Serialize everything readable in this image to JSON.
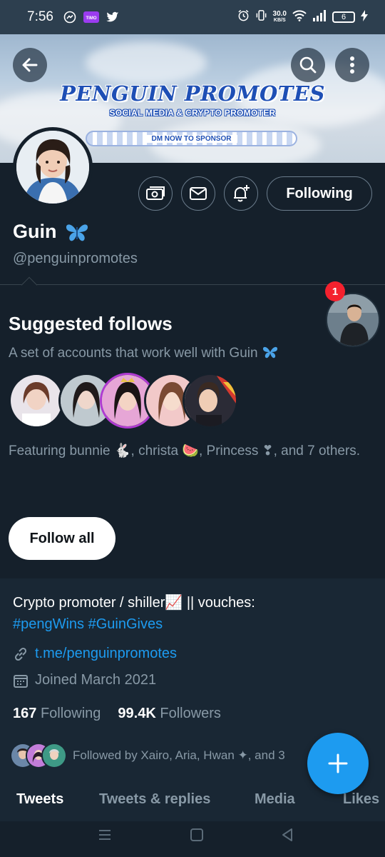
{
  "status_bar": {
    "time": "7:56",
    "net_speed_value": "30.0",
    "net_speed_unit": "KB/S",
    "battery": "6"
  },
  "banner": {
    "title": "PENGUIN PROMOTES",
    "subtitle": "SOCIAL MEDIA & CRYPTO PROMOTER",
    "cta": "DM NOW TO SPONSOR"
  },
  "profile": {
    "name": "Guin",
    "name_emoji": "butterfly",
    "handle": "@penguinpromotes",
    "following_button": "Following"
  },
  "suggested": {
    "title": "Suggested follows",
    "description": "A set of accounts that work well with Guin",
    "featuring": "Featuring bunnie 🐇, christa 🍉, Princess ❣, and 7 others.",
    "follow_all": "Follow all",
    "badge_count": "1"
  },
  "bio": {
    "text": "Crypto promoter / shiller📈 || vouches:",
    "hashtags": "#pengWins #GuinGives",
    "link": "t.me/penguinpromotes",
    "joined": "Joined March 2021",
    "following_count": "167",
    "following_label": "Following",
    "followers_count": "99.4K",
    "followers_label": "Followers",
    "followed_by": "Followed by Xairo, Aria, Hwan ✦, and 3"
  },
  "tabs": [
    "Tweets",
    "Tweets & replies",
    "Media",
    "Likes"
  ],
  "colors": {
    "background": "#15202b",
    "accent": "#1d9bf0",
    "secondary_text": "#8899a6"
  }
}
